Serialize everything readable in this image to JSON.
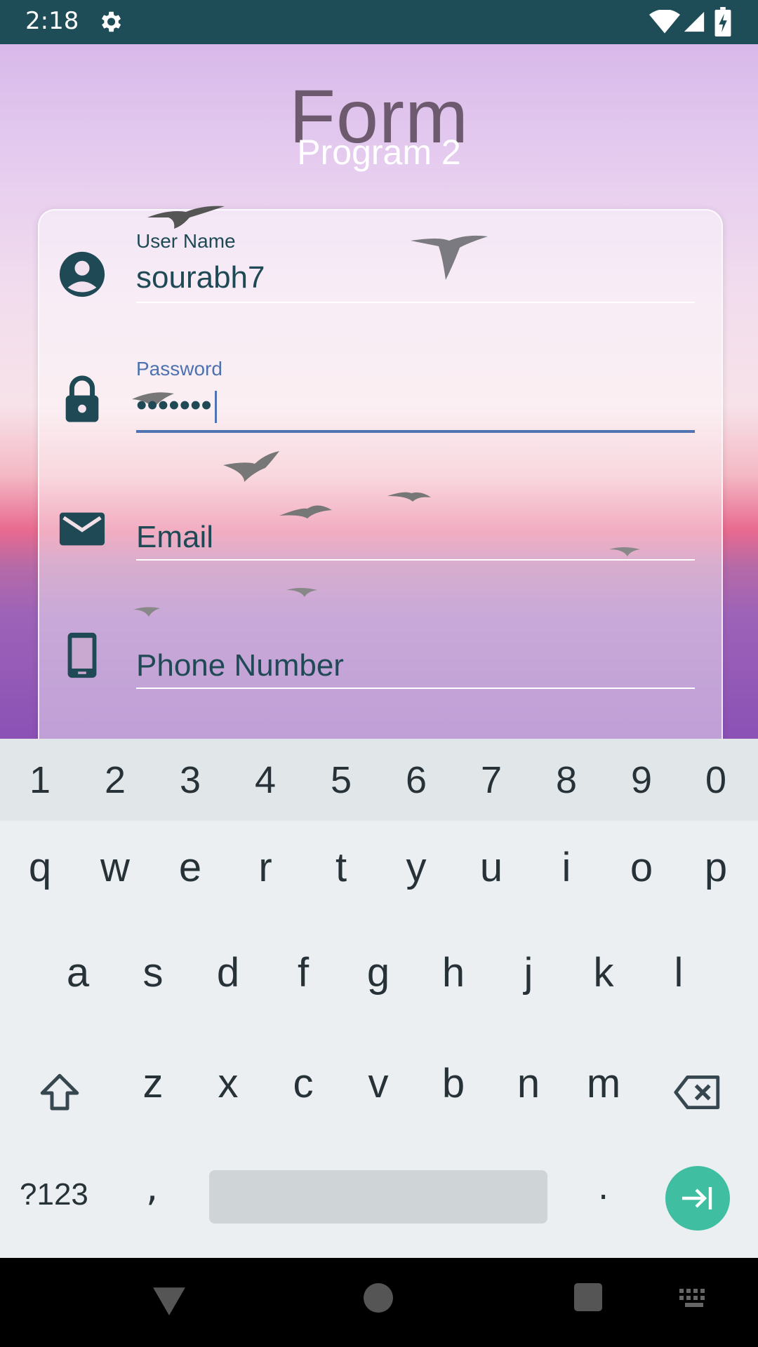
{
  "status": {
    "time": "2:18"
  },
  "header": {
    "title": "Form",
    "subtitle": "Program 2"
  },
  "form": {
    "username": {
      "label": "User Name",
      "value": "sourabh7"
    },
    "password": {
      "label": "Password",
      "value": "•••••••"
    },
    "email": {
      "placeholder": "Email"
    },
    "phone": {
      "placeholder": "Phone Number"
    }
  },
  "keyboard": {
    "numbers": [
      "1",
      "2",
      "3",
      "4",
      "5",
      "6",
      "7",
      "8",
      "9",
      "0"
    ],
    "row1": [
      "q",
      "w",
      "e",
      "r",
      "t",
      "y",
      "u",
      "i",
      "o",
      "p"
    ],
    "row2": [
      "a",
      "s",
      "d",
      "f",
      "g",
      "h",
      "j",
      "k",
      "l"
    ],
    "row3": [
      "z",
      "x",
      "c",
      "v",
      "b",
      "n",
      "m"
    ],
    "symbols_label": "?123",
    "comma": ",",
    "period": "."
  },
  "colors": {
    "statusbar": "#1e4d57",
    "accent": "#5074b2",
    "enter_key": "#3fbea1"
  }
}
